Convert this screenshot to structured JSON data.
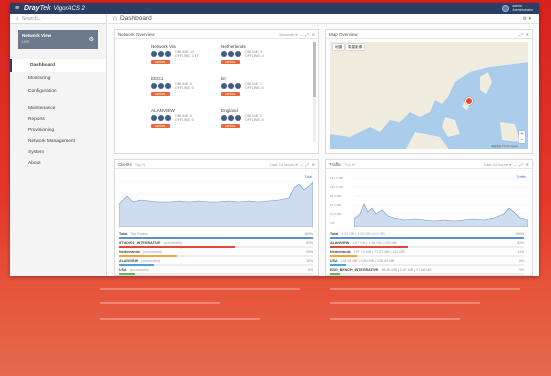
{
  "topbar": {
    "brand": "Dray",
    "brand2": "Tek",
    "product": "VigorACS 2",
    "user_line1": "admin",
    "user_line2": "Administrator"
  },
  "sidebar": {
    "search_placeholder": "Search...",
    "network": {
      "title": "Network View",
      "subtitle": "LIVE"
    },
    "items": [
      {
        "label": "Dashboard",
        "active": true
      },
      {
        "label": "Monitoring"
      },
      {
        "label": "Configuration"
      }
    ],
    "items2": [
      {
        "label": "Maintenance"
      },
      {
        "label": "Reports"
      },
      {
        "label": "Provisioning"
      },
      {
        "label": "Network Management"
      },
      {
        "label": "System"
      },
      {
        "label": "About"
      }
    ]
  },
  "main": {
    "title": "Dashboard"
  },
  "network_overview": {
    "title": "Network Overview",
    "dropdown": "Network ▾",
    "sites": [
      {
        "name": "Network Via",
        "online": "ONLINE: 13",
        "offline": "OFFLINE: 2",
        "offline_alert": "17",
        "button": "DETAIL"
      },
      {
        "name": "Netherlands",
        "online": "ONLINE: 3",
        "offline": "OFFLINE: 0",
        "offline_alert": "",
        "button": "DETAIL"
      },
      {
        "name": "EEG1",
        "online": "ONLINE: 0",
        "offline": "OFFLINE: 0",
        "offline_alert": "",
        "button": "DETAIL"
      },
      {
        "name": "kit",
        "online": "ONLINE: 1",
        "offline": "OFFLINE: 0",
        "offline_alert": "",
        "button": "DETAIL"
      },
      {
        "name": "ALANVIEW",
        "online": "ONLINE: 0",
        "offline": "OFFLINE: 0",
        "offline_alert": "",
        "button": "DETAIL"
      },
      {
        "name": "England",
        "online": "ONLINE: 2",
        "offline": "OFFLINE: 0",
        "offline_alert": "",
        "button": "DETAIL"
      }
    ]
  },
  "map_overview": {
    "title": "Map Overview",
    "tab1": "地圖",
    "tab2": "衛星影像",
    "attribution": "地圖資料 ©2018 Google",
    "zoom_in": "+",
    "zoom_out": "−"
  },
  "clients": {
    "title": "Clients",
    "subtitle": "Top N",
    "dropdown": "Last 24 hours ▾",
    "legend": "Total",
    "rows": [
      {
        "label": "Total",
        "sub": "Top Ratios",
        "pct": "100%",
        "color": "#5d8fd6",
        "fill": 1.0
      },
      {
        "label": "STUDIO1_INTEGRATIVE",
        "sub": "(connected)",
        "pct": "50%",
        "color": "#e04a3a",
        "fill": 0.6
      },
      {
        "label": "Netherlands",
        "sub": "(connected)",
        "pct": "20%",
        "color": "#f0a640",
        "fill": 0.3
      },
      {
        "label": "ALANVIEW",
        "sub": "(connected)",
        "pct": "10%",
        "color": "#4aa3d9",
        "fill": 0.18
      },
      {
        "label": "USA",
        "sub": "(connected)",
        "pct": "5%",
        "color": "#6bb26b",
        "fill": 0.08
      }
    ]
  },
  "traffic": {
    "title": "Traffic",
    "subtitle": "Top N",
    "dropdown": "Last 24 hours ▾",
    "legend": "Traffic",
    "y_ticks": [
      "157.7 MB",
      "126.1 MB",
      "94.6 MB",
      "63.1 MB",
      "31.5 MB",
      "0 B"
    ],
    "rows": [
      {
        "label": "Total",
        "sub": "1.92 GB | 1.02 GB | 0.9 GB",
        "pct": "100%",
        "color": "#5d8fd6",
        "fill": 1.0
      },
      {
        "label": "ALANVIEW",
        "sub": "1.57 GB | 1.46 GB | 120 MB",
        "pct": "82%",
        "color": "#e04a3a",
        "fill": 0.4
      },
      {
        "label": "Netherlands",
        "sub": "197.75 MB | 77.37 MB | 120 MB",
        "pct": "11%",
        "color": "#f0a640",
        "fill": 0.14
      },
      {
        "label": "USA",
        "sub": "118.39 MB | 9.84 MB | 108.55 MB",
        "pct": "6%",
        "color": "#4aa3d9",
        "fill": 0.08
      },
      {
        "label": "ENG_BENCH_INTEGRATIVE",
        "sub": "98.85 MB | 0.97 MB | 97.88 MB",
        "pct": "5%",
        "color": "#6bb26b",
        "fill": 0.05
      }
    ]
  },
  "colors": {
    "topbar": "#2c3e64",
    "accent": "#e46a3b",
    "background": "#d8221c"
  }
}
